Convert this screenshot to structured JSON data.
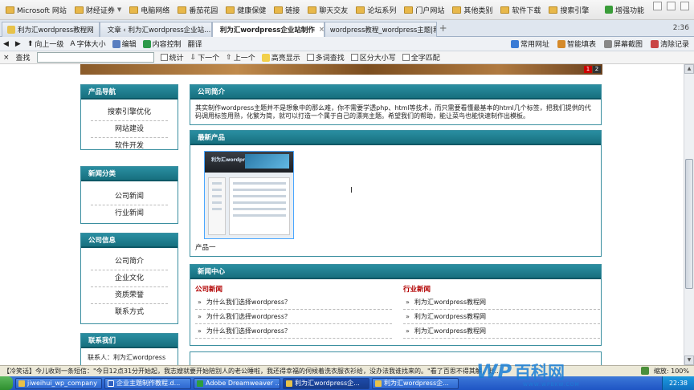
{
  "favorites": {
    "items": [
      "Microsoft 网站",
      "财经证券",
      "电脑网络",
      "番茄花园",
      "健康保健",
      "链接",
      "聊天交友",
      "论坛系列",
      "门户网站",
      "其他类别",
      "软件下载",
      "搜索引擎"
    ],
    "enhance": "增强功能"
  },
  "tabs": {
    "items": [
      {
        "label": "利为汇wordpress教程网"
      },
      {
        "label": "文章 ‹ 利为汇wordpress企业站..."
      },
      {
        "label": "利为汇wordpress企业站制作"
      },
      {
        "label": "wordpress教程_wordpress主题|利..."
      }
    ],
    "time": "2:36"
  },
  "toolbar": {
    "up": "向上一级",
    "font": "字体大小",
    "edit": "编辑",
    "content_control": "内容控制",
    "translate": "翻译",
    "common_sites": "常用网址",
    "smart_fill": "智能填表",
    "screenshot": "屏幕截图",
    "clear_history": "清除记录"
  },
  "findbar": {
    "label": "查找",
    "input_value": "",
    "count": "统计",
    "next": "下一个",
    "prev": "上一个",
    "highlight": "高亮显示",
    "multi": "多词查找",
    "case": "区分大小写",
    "whole": "全字匹配"
  },
  "banner": {
    "pages": [
      "1",
      "2"
    ]
  },
  "sidebar": {
    "product_nav": {
      "title": "产品导航",
      "items": [
        "搜索引擎优化",
        "网站建设",
        "软件开发"
      ]
    },
    "news_cats": {
      "title": "新闻分类",
      "items": [
        "公司新闻",
        "行业新闻"
      ]
    },
    "company_info": {
      "title": "公司信息",
      "items": [
        "公司简介",
        "企业文化",
        "资质荣誉",
        "联系方式"
      ]
    },
    "contact": {
      "title": "联系我们",
      "contact_person": "联系人：利为汇wordpress"
    }
  },
  "main": {
    "about": {
      "title": "公司简介",
      "text": "其实制作wordpress主题并不是想象中的那么难，你不需要学透php、html等技术，而只需要看懂最基本的html几个标签，把我们提供的代码调用标签用熟，化繁为简，就可以打造一个属于自己的漂亮主题。希望我们的帮助，能让菜鸟也能快速制作出模板。"
    },
    "latest": {
      "title": "最新产品",
      "product_name": "产品一",
      "thumb_logo": "利为汇wordpress教程网"
    },
    "news_center": {
      "title": "新闻中心",
      "company_news": {
        "title": "公司新闻",
        "items": [
          "为什么我们选择wordpress？",
          "为什么我们选择wordpress？",
          "为什么我们选择wordpress？"
        ]
      },
      "industry_news": {
        "title": "行业新闻",
        "items": [
          "利为汇wordpress教程网",
          "利为汇wordpress教程网",
          "利为汇wordpress教程网"
        ]
      }
    }
  },
  "statusbar": {
    "text": "【冷笑话】今儿收到一条短信：\"今日12点31分开始起，我志嫂就要开始陪别人的老公睡啦，我还得幸福的伺候着洗衣服衣衫给，没办法我谁找来的。\"看了百思不得其解，此..",
    "zoom": "缩放: 100%"
  },
  "taskbar": {
    "tasks": [
      "jiweihui_wp_company",
      "企业主题制作教程.d...",
      "Adobe Dreamweaver ...",
      "利为汇wordpress企...",
      "利为汇wordpress企..."
    ],
    "clock": "22:38"
  },
  "watermark": {
    "latin": "WP",
    "cn": "百科网",
    "sub": "WWW.WPBKW.COM"
  },
  "colors": {
    "header_teal": "#17707f",
    "news_red": "#b20000",
    "taskbar_blue": "#1f55c4"
  }
}
